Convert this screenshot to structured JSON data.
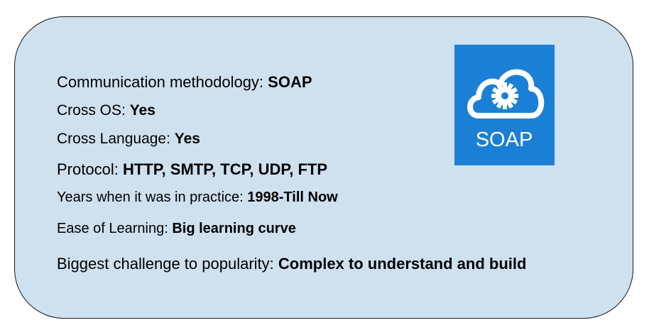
{
  "card": {
    "background": "#cfe0ef",
    "border_color": "#1a1a1a"
  },
  "lines": [
    {
      "label": "Communication methodology: ",
      "value": "SOAP"
    },
    {
      "label": "Cross OS: ",
      "value": "Yes"
    },
    {
      "label": "Cross Language: ",
      "value": "Yes"
    },
    {
      "label": "Protocol: ",
      "value": "HTTP, SMTP, TCP, UDP, FTP"
    },
    {
      "label": "Years when it was in practice: ",
      "value": "1998-Till Now"
    },
    {
      "label": "Ease of Learning: ",
      "value": "Big learning curve"
    },
    {
      "label": "Biggest challenge to popularity: ",
      "value": "Complex to understand and build"
    }
  ],
  "logo": {
    "icon": "cloud-gear-icon",
    "text": "SOAP",
    "background": "#1b80d5",
    "foreground": "#ffffff"
  }
}
